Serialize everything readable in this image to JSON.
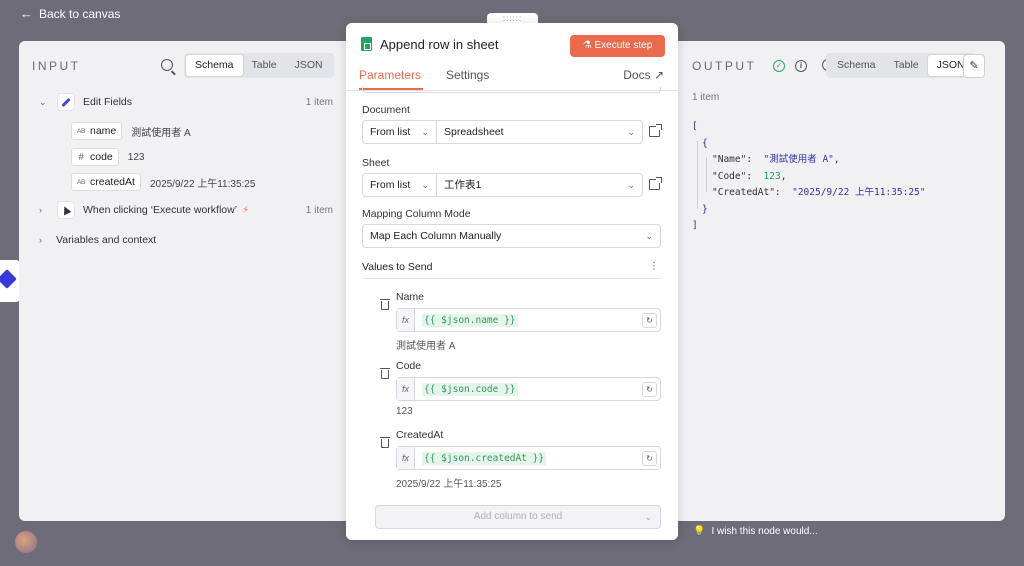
{
  "topbar": {
    "back_label": "Back to canvas"
  },
  "input": {
    "title": "INPUT",
    "tabs": [
      "Schema",
      "Table",
      "JSON"
    ],
    "active_tab": "Schema",
    "nodes": [
      {
        "label": "Edit Fields",
        "count": "1 item",
        "expanded": true
      },
      {
        "label": "When clicking ‘Execute workflow’",
        "count": "1 item",
        "expanded": false
      },
      {
        "label": "Variables and context"
      }
    ],
    "fields": [
      {
        "type": "AB",
        "name": "name",
        "value": "測試使用者 A"
      },
      {
        "type": "#",
        "name": "code",
        "value": "123"
      },
      {
        "type": "AB",
        "name": "createdAt",
        "value": "2025/9/22 上午11:35:25"
      }
    ]
  },
  "modal": {
    "title": "Append row in sheet",
    "execute_label": "Execute step",
    "tabs": [
      "Parameters",
      "Settings"
    ],
    "docs_label": "Docs",
    "document": {
      "label": "Document",
      "mode": "From list",
      "value": "Spreadsheet"
    },
    "sheet": {
      "label": "Sheet",
      "mode": "From list",
      "value": "工作表1"
    },
    "mapping": {
      "label": "Mapping Column Mode",
      "value": "Map Each Column Manually"
    },
    "values_label": "Values to Send",
    "columns": [
      {
        "name": "Name",
        "expr": "{{ $json.name }}",
        "preview": "測試使用者 A"
      },
      {
        "name": "Code",
        "expr": "{{ $json.code }}",
        "preview": "123"
      },
      {
        "name": "CreatedAt",
        "expr": "{{ $json.createdAt }}",
        "preview": "2025/9/22 上午11:35:25"
      }
    ],
    "add_column_placeholder": "Add column to send",
    "fx_label": "fx"
  },
  "output": {
    "title": "OUTPUT",
    "tabs": [
      "Schema",
      "Table",
      "JSON"
    ],
    "active_tab": "JSON",
    "items_label": "1 item",
    "json": {
      "open_bracket": "[",
      "open_brace": "{",
      "rows": [
        {
          "key": "\"Name\"",
          "value": "\"測試使用者 A\"",
          "kind": "str",
          "comma": ","
        },
        {
          "key": "\"Code\"",
          "value": "123",
          "kind": "num",
          "comma": ","
        },
        {
          "key": "\"CreatedAt\"",
          "value": "\"2025/9/22 上午11:35:25\"",
          "kind": "str",
          "comma": ""
        }
      ],
      "close_brace": "}",
      "close_bracket": "]"
    }
  },
  "feedback_label": "I wish this node would..."
}
